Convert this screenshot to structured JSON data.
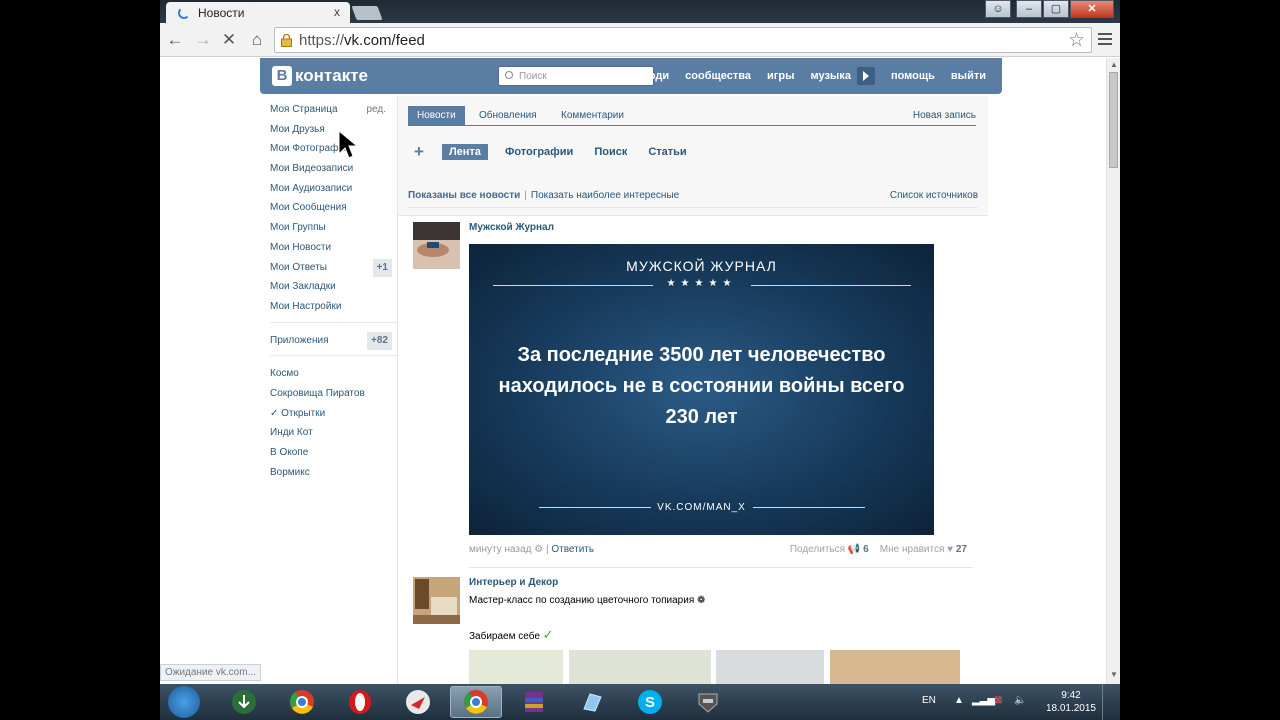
{
  "browser": {
    "tab_title": "Новости",
    "tab_close": "x",
    "url_scheme": "https://",
    "url_host": "vk.com/feed",
    "status_text": "Ожидание vk.com..."
  },
  "vk": {
    "logo_letter": "В",
    "logo_text": "контакте",
    "search_placeholder": "Поиск",
    "nav": [
      "люди",
      "сообщества",
      "игры",
      "музыка",
      "помощь",
      "выйти"
    ],
    "left_menu": {
      "my_page": "Моя Страница",
      "edit": "ред.",
      "items": [
        "Мои Друзья",
        "Мои Фотографии",
        "Мои Видеозаписи",
        "Мои Аудиозаписи",
        "Мои Сообщения",
        "Мои Группы",
        "Мои Новости",
        "Мои Ответы",
        "Мои Закладки",
        "Мои Настройки"
      ],
      "answers_count": "+1",
      "apps": "Приложения",
      "apps_count": "+82",
      "games": [
        "Космо",
        "Сокровища Пиратов",
        "✓ Открытки",
        "Инди Кот",
        "В Окопе",
        "Вормикс"
      ]
    },
    "tabs": [
      "Новости",
      "Обновления",
      "Комментарии"
    ],
    "new_post": "Новая запись",
    "subtabs": [
      "Лента",
      "Фотографии",
      "Поиск",
      "Статьи"
    ],
    "filter": {
      "all_news": "Показаны все новости",
      "interesting": "Показать наиболее интересные",
      "sources": "Список источников"
    },
    "post1": {
      "author": "Мужской Журнал",
      "image_brand": "МУЖСКОЙ ЖУРНАЛ",
      "image_stars": "★★★★★",
      "image_quote": "За последние 3500 лет человечество находилось не в состоянии войны всего 230 лет",
      "image_site": "VK.COM/MAN_X",
      "time": "минуту назад",
      "reply": "Ответить",
      "share": "Поделиться",
      "share_count": "6",
      "like": "Мне нравится",
      "like_count": "27"
    },
    "post2": {
      "author": "Интерьер и Декор",
      "text": "Мастер-класс по созданию цветочного топиария",
      "text2": "Забираем себе"
    }
  },
  "taskbar": {
    "lang": "EN",
    "time": "9:42",
    "date": "18.01.2015"
  },
  "colors": {
    "vk_blue": "#597da3",
    "link": "#2b587a"
  }
}
